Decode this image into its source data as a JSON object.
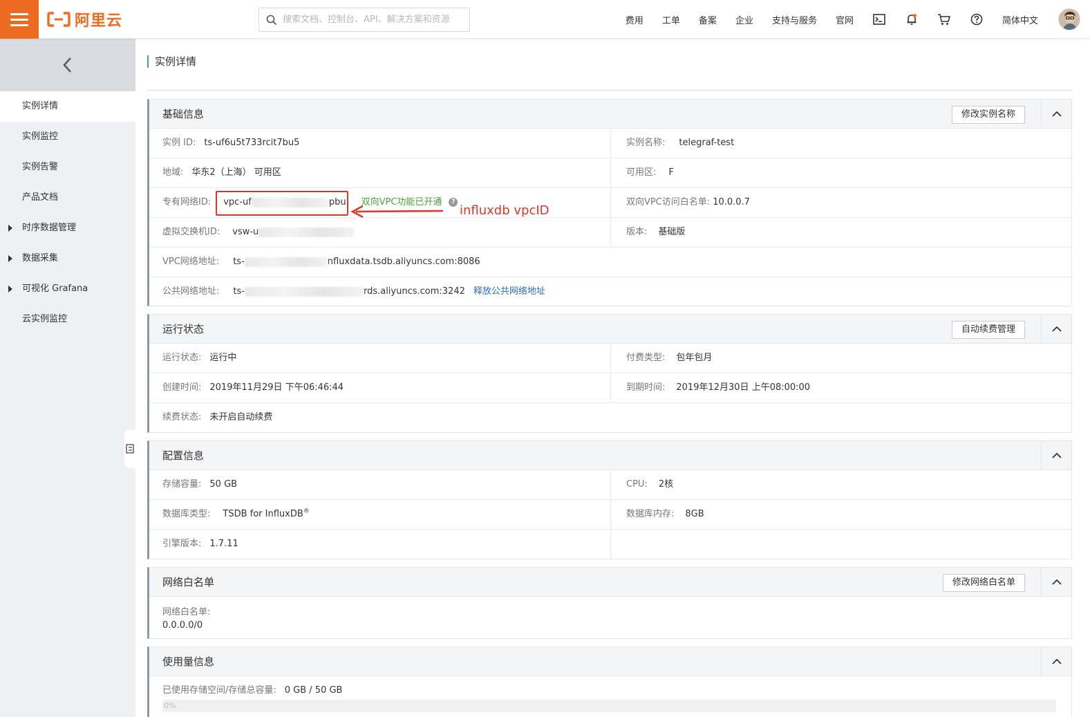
{
  "header": {
    "logo_text": "阿里云",
    "search_placeholder": "搜索文档、控制台、API、解决方案和资源",
    "nav": [
      "费用",
      "工单",
      "备案",
      "企业",
      "支持与服务",
      "官网"
    ],
    "language": "简体中文"
  },
  "sidebar": {
    "items": [
      {
        "label": "实例详情"
      },
      {
        "label": "实例监控"
      },
      {
        "label": "实例告警"
      },
      {
        "label": "产品文档"
      },
      {
        "label": "时序数据管理"
      },
      {
        "label": "数据采集"
      },
      {
        "label": "可视化 Grafana"
      },
      {
        "label": "云实例监控"
      }
    ]
  },
  "page": {
    "title": "实例详情"
  },
  "basic": {
    "title": "基础信息",
    "btn": "修改实例名称",
    "instance_id_label": "实例 ID:",
    "instance_id": "ts-uf6u5t733rcit7bu5",
    "instance_name_label": "实例名称:",
    "instance_name": "telegraf-test",
    "region_label": "地域:",
    "region": "华东2（上海） 可用区",
    "zone_label": "可用区:",
    "zone": "F",
    "vpc_label": "专有网络ID:",
    "vpc_visible_prefix": "vpc-uf",
    "vpc_visible_suffix": "pbu",
    "vpc_status": "双向VPC功能已开通",
    "whitelist_label": "双向VPC访问白名单:",
    "whitelist": "10.0.0.7",
    "vsw_label": "虚拟交换机ID:",
    "vsw_visible_prefix": "vsw-u",
    "version_label": "版本:",
    "version": "基础版",
    "vpc_addr_label": "VPC网络地址:",
    "vpc_addr_prefix": "ts-",
    "vpc_addr_suffix": "nfluxdata.tsdb.aliyuncs.com:8086",
    "public_addr_label": "公共网络地址:",
    "public_addr_prefix": "ts-",
    "public_addr_suffix": "rds.aliyuncs.com:3242",
    "release_link": "释放公共网络地址"
  },
  "annotation": "influxdb vpcID",
  "status": {
    "title": "运行状态",
    "btn": "自动续费管理",
    "run_label": "运行状态:",
    "run": "运行中",
    "pay_label": "付费类型:",
    "pay": "包年包月",
    "created_label": "创建时间:",
    "created": "2019年11月29日 下午06:46:44",
    "expire_label": "到期时间:",
    "expire": "2019年12月30日 上午08:00:00",
    "renew_label": "续费状态:",
    "renew": "未开启自动续费"
  },
  "config": {
    "title": "配置信息",
    "storage_label": "存储容量:",
    "storage": "50 GB",
    "cpu_label": "CPU:",
    "cpu": "2核",
    "dbtype_label": "数据库类型:",
    "dbtype": "TSDB for InfluxDB",
    "dbtype_mark": "®",
    "mem_label": "数据库内存:",
    "mem": "8GB",
    "engine_label": "引擎版本:",
    "engine": "1.7.11"
  },
  "whitelist_panel": {
    "title": "网络白名单",
    "btn": "修改网络白名单",
    "label": "网络白名单:",
    "value": "0.0.0.0/0"
  },
  "usage": {
    "title": "使用量信息",
    "label": "已使用存储空间/存储总容量:",
    "value": "0 GB / 50 GB",
    "progress_text": "0%",
    "progress": 0
  },
  "colors": {
    "brand": "#ec6b20",
    "annotation": "#d8372b",
    "link": "#2d6ec2",
    "success": "#4aa03a"
  }
}
